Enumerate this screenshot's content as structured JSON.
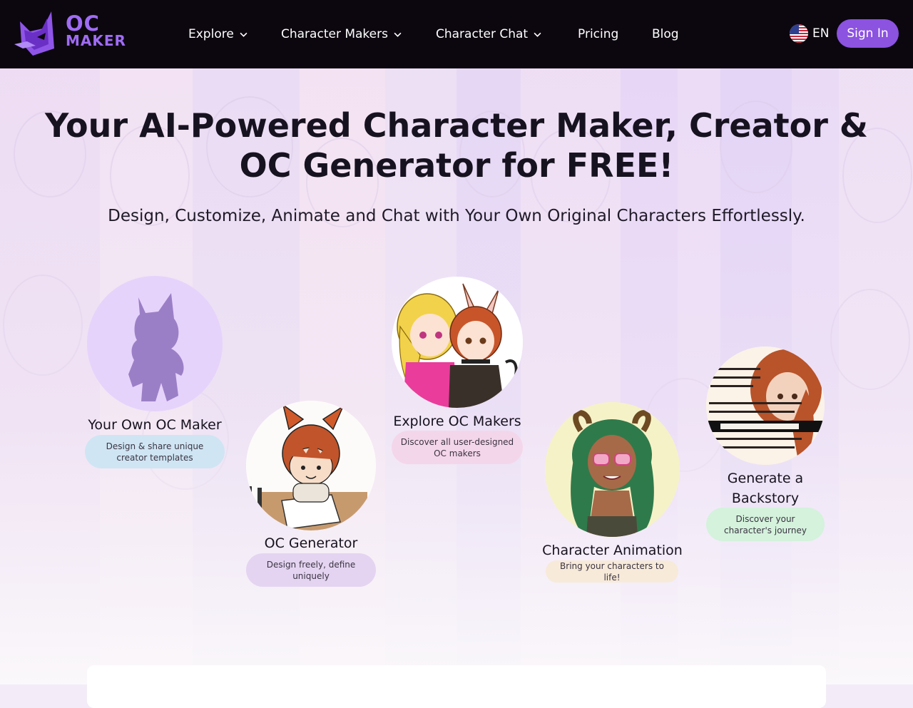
{
  "nav": {
    "logo_text_top": "OC",
    "logo_text_bottom": "MAKER",
    "items": [
      {
        "label": "Explore",
        "has_dropdown": true
      },
      {
        "label": "Character Makers",
        "has_dropdown": true
      },
      {
        "label": "Character Chat",
        "has_dropdown": true
      },
      {
        "label": "Pricing",
        "has_dropdown": false
      },
      {
        "label": "Blog",
        "has_dropdown": false
      }
    ],
    "language": "EN",
    "sign_in": "Sign In"
  },
  "hero": {
    "title_line1": "Your AI-Powered Character Maker, Creator &",
    "title_line2": "OC Generator for FREE!",
    "subtitle": "Design, Customize, Animate and Chat with Your Own Original Characters Effortlessly."
  },
  "features": [
    {
      "title": "Your Own OC Maker",
      "desc": "Design & share unique creator templates",
      "pill_color": "#cfe5f3",
      "icon": "silhouette-icon"
    },
    {
      "title": "OC Generator",
      "desc": "Design freely, define uniquely",
      "pill_color": "#e4d4f1",
      "icon": "fox-kid-drawing-image"
    },
    {
      "title": "Explore OC Makers",
      "desc": "Discover all user-designed OC makers",
      "pill_color": "#f4d6ea",
      "icon": "two-anime-girls-image"
    },
    {
      "title": "Character Animation",
      "desc": "Bring your characters to life!",
      "pill_color": "#f7ead9",
      "icon": "green-hair-girl-image"
    },
    {
      "title": "Generate a Backstory",
      "desc": "Discover your character's journey",
      "pill_color": "#d4f2dc",
      "icon": "backstory-scroll-image"
    }
  ],
  "colors": {
    "nav_bg": "#0c070f",
    "accent": "#8c52e0",
    "logo": "#9f6cf3"
  }
}
